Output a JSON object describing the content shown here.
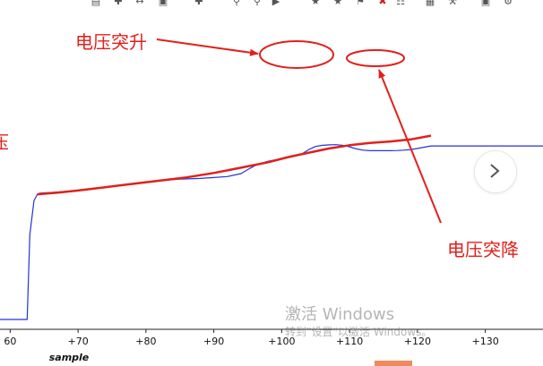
{
  "toolbar": {
    "icons": [
      "align-icon",
      "pin-icon",
      "fit-icon",
      "export-icon",
      "add-icon",
      "dropdown-icon",
      "zoom-in-icon",
      "zoom-out-icon",
      "cursor-icon",
      "dropdown-icon",
      "star-icon",
      "star-active-icon",
      "bookmark-icon",
      "delete-icon",
      "copy-icon",
      "grid-icon",
      "tools-icon",
      "lock-icon",
      "settings-icon"
    ]
  },
  "chart_data": {
    "type": "line",
    "title": "",
    "xlabel": "sample",
    "ylabel": "",
    "xlim": [
      58.5,
      138.5
    ],
    "x_ticks": [
      "60",
      "+70",
      "+80",
      "+90",
      "+100",
      "+110",
      "+120",
      "+130"
    ],
    "x_tick_values": [
      60,
      70,
      80,
      90,
      100,
      110,
      120,
      130
    ],
    "ylim": [
      0,
      100
    ],
    "grid": false,
    "series": [
      {
        "color": "#2233dd",
        "x": [
          58.5,
          62.5,
          62.9,
          63.5,
          64.0,
          64.4,
          67,
          70,
          74,
          78,
          80,
          83,
          85,
          88,
          90,
          92,
          94,
          95,
          96,
          97,
          98,
          99,
          100,
          101,
          102,
          103,
          104,
          105,
          106,
          107,
          108,
          109,
          110,
          111,
          112,
          113,
          114,
          115,
          116,
          117,
          118,
          119,
          120,
          121,
          122,
          123,
          124,
          125,
          126,
          127,
          128,
          129,
          130,
          131,
          132,
          133,
          134,
          135,
          136,
          137,
          138.5
        ],
        "y": [
          0.0,
          0.0,
          54.3,
          76.0,
          80.2,
          80.9,
          81.6,
          82.6,
          84.7,
          86.8,
          87.8,
          89.2,
          89.9,
          90.3,
          90.9,
          91.5,
          93.4,
          96.0,
          98.4,
          100.0,
          101.3,
          102.2,
          103.2,
          103.8,
          104.7,
          106.1,
          108.8,
          110.8,
          111.5,
          111.8,
          111.9,
          111.5,
          110.6,
          109.2,
          108.4,
          108.1,
          108.1,
          108.1,
          108.1,
          108.2,
          108.4,
          108.8,
          109.5,
          110.3,
          111.1,
          111.1,
          111.1,
          111.1,
          111.1,
          111.1,
          111.1,
          111.1,
          111.1,
          111.1,
          111.1,
          111.1,
          111.1,
          111.1,
          111.1,
          111.1,
          111.1
        ]
      },
      {
        "color": "#e0201c",
        "x": [
          64.0,
          67,
          70,
          74,
          78,
          82,
          86,
          90,
          94,
          98,
          101,
          104,
          107,
          110,
          113,
          116,
          119,
          122
        ],
        "y": [
          80.2,
          81.2,
          82.6,
          84.7,
          86.8,
          88.9,
          91.0,
          93.8,
          97.2,
          100.7,
          104.0,
          106.8,
          109.5,
          111.6,
          113.0,
          114.0,
          115.3,
          117.7
        ]
      }
    ],
    "annotations": [
      "电压突升",
      "电压突降",
      "压"
    ]
  },
  "watermark": {
    "title": "激活 Windows",
    "subtitle": "转到\"设置\"以激活 Windows。"
  },
  "nav": {
    "next_icon": "chevron-right-icon"
  }
}
